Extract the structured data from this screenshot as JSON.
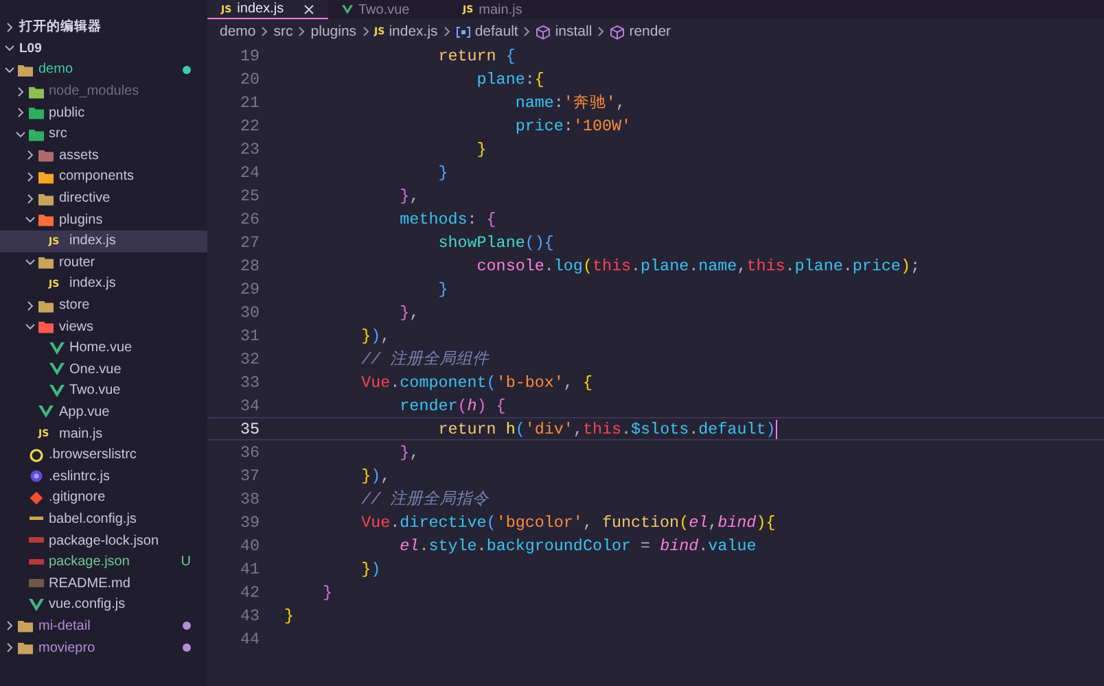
{
  "sidebar": {
    "items": [
      {
        "name": "打开的编辑器",
        "kind": "section",
        "expanded": false,
        "selected": false
      },
      {
        "name": "L09",
        "kind": "section",
        "expanded": true,
        "selected": false,
        "children": [
          {
            "name": "demo",
            "kind": "folder",
            "expanded": true,
            "selected": false,
            "color": "#3ec9a7",
            "dot": true,
            "children": [
              {
                "name": "node_modules",
                "kind": "folder-node",
                "expanded": false,
                "selected": false,
                "color": "#6f6c80"
              },
              {
                "name": "public",
                "kind": "folder-public",
                "expanded": false,
                "selected": false
              },
              {
                "name": "src",
                "kind": "folder-src",
                "expanded": true,
                "selected": false,
                "children": [
                  {
                    "name": "assets",
                    "kind": "folder-assets",
                    "expanded": false,
                    "selected": false
                  },
                  {
                    "name": "components",
                    "kind": "folder-components",
                    "expanded": false,
                    "selected": false
                  },
                  {
                    "name": "directive",
                    "kind": "folder",
                    "expanded": false,
                    "selected": false
                  },
                  {
                    "name": "plugins",
                    "kind": "folder-plugins",
                    "expanded": true,
                    "selected": false,
                    "children": [
                      {
                        "name": "index.js",
                        "kind": "js",
                        "icon_label": "JS",
                        "selected": true
                      }
                    ]
                  },
                  {
                    "name": "router",
                    "kind": "folder",
                    "expanded": true,
                    "selected": false,
                    "children": [
                      {
                        "name": "index.js",
                        "kind": "js",
                        "icon_label": "JS",
                        "selected": false
                      }
                    ]
                  },
                  {
                    "name": "store",
                    "kind": "folder",
                    "expanded": false,
                    "selected": false
                  },
                  {
                    "name": "views",
                    "kind": "folder-views",
                    "expanded": true,
                    "selected": false,
                    "children": [
                      {
                        "name": "Home.vue",
                        "kind": "vue",
                        "selected": false
                      },
                      {
                        "name": "One.vue",
                        "kind": "vue",
                        "selected": false
                      },
                      {
                        "name": "Two.vue",
                        "kind": "vue",
                        "selected": false
                      }
                    ]
                  },
                  {
                    "name": "App.vue",
                    "kind": "vue",
                    "selected": false
                  },
                  {
                    "name": "main.js",
                    "kind": "js",
                    "icon_label": "JS",
                    "selected": false
                  }
                ]
              },
              {
                "name": ".browserslistrc",
                "kind": "ring",
                "selected": false
              },
              {
                "name": ".eslintrc.js",
                "kind": "eslint",
                "selected": false
              },
              {
                "name": ".gitignore",
                "kind": "git",
                "selected": false
              },
              {
                "name": "babel.config.js",
                "kind": "babel",
                "selected": false
              },
              {
                "name": "package-lock.json",
                "kind": "npm",
                "selected": false
              },
              {
                "name": "package.json",
                "kind": "npm",
                "selected": false,
                "color": "#73c991",
                "badge": "U"
              },
              {
                "name": "README.md",
                "kind": "readme",
                "selected": false
              },
              {
                "name": "vue.config.js",
                "kind": "vue",
                "selected": false
              }
            ]
          },
          {
            "name": "mi-detail",
            "kind": "folder",
            "expanded": false,
            "selected": false,
            "color": "#b38ed6",
            "dot": true
          },
          {
            "name": "moviepro",
            "kind": "folder",
            "expanded": false,
            "selected": false,
            "color": "#b38ed6",
            "dot": true
          }
        ]
      }
    ]
  },
  "tabs": [
    {
      "label": "index.js",
      "kind": "js",
      "icon_label": "JS",
      "selected": true,
      "closable": true
    },
    {
      "label": "Two.vue",
      "kind": "vue",
      "selected": false,
      "closable": false
    },
    {
      "label": "main.js",
      "kind": "js",
      "icon_label": "JS",
      "selected": false,
      "closable": false
    }
  ],
  "breadcrumb": [
    {
      "text": "demo",
      "kind": "plain"
    },
    {
      "text": "src",
      "kind": "plain"
    },
    {
      "text": "plugins",
      "kind": "plain"
    },
    {
      "text": "index.js",
      "kind": "js",
      "icon_label": "JS"
    },
    {
      "text": "default",
      "kind": "variable"
    },
    {
      "text": "install",
      "kind": "method"
    },
    {
      "text": "render",
      "kind": "method"
    }
  ],
  "editor": {
    "lines": [
      {
        "number": "19",
        "current": false,
        "tokens": [
          {
            "kind": "keyword",
            "text": "                return"
          },
          {
            "kind": "b3",
            "text": " {"
          }
        ]
      },
      {
        "number": "20",
        "current": false,
        "tokens": [
          {
            "kind": "prop",
            "text": "                    plane"
          },
          {
            "kind": "punct",
            "text": ":"
          },
          {
            "kind": "b1",
            "text": "{"
          }
        ]
      },
      {
        "number": "21",
        "current": false,
        "tokens": [
          {
            "kind": "prop",
            "text": "                        name"
          },
          {
            "kind": "punct",
            "text": ":"
          },
          {
            "kind": "string",
            "text": "'奔驰'"
          },
          {
            "kind": "punct",
            "text": ","
          }
        ]
      },
      {
        "number": "22",
        "current": false,
        "tokens": [
          {
            "kind": "prop",
            "text": "                        price"
          },
          {
            "kind": "punct",
            "text": ":"
          },
          {
            "kind": "string",
            "text": "'100W'"
          }
        ]
      },
      {
        "number": "23",
        "current": false,
        "tokens": [
          {
            "kind": "b1",
            "text": "                    }"
          }
        ]
      },
      {
        "number": "24",
        "current": false,
        "tokens": [
          {
            "kind": "b3",
            "text": "                }"
          }
        ]
      },
      {
        "number": "25",
        "current": false,
        "tokens": [
          {
            "kind": "b2",
            "text": "            }"
          },
          {
            "kind": "punct",
            "text": ","
          }
        ]
      },
      {
        "number": "26",
        "current": false,
        "tokens": [
          {
            "kind": "prop",
            "text": "            methods"
          },
          {
            "kind": "punct",
            "text": ":"
          },
          {
            "kind": "b2",
            "text": " {"
          }
        ]
      },
      {
        "number": "27",
        "current": false,
        "tokens": [
          {
            "kind": "method",
            "text": "                showPlane"
          },
          {
            "kind": "b3",
            "text": "(){"
          }
        ]
      },
      {
        "number": "28",
        "current": false,
        "tokens": [
          {
            "kind": "object",
            "text": "                    console"
          },
          {
            "kind": "punct",
            "text": "."
          },
          {
            "kind": "prop",
            "text": "log"
          },
          {
            "kind": "b1",
            "text": "("
          },
          {
            "kind": "this",
            "text": "this"
          },
          {
            "kind": "punct",
            "text": "."
          },
          {
            "kind": "prop",
            "text": "plane"
          },
          {
            "kind": "punct",
            "text": "."
          },
          {
            "kind": "prop",
            "text": "name"
          },
          {
            "kind": "punct",
            "text": ","
          },
          {
            "kind": "this",
            "text": "this"
          },
          {
            "kind": "punct",
            "text": "."
          },
          {
            "kind": "prop",
            "text": "plane"
          },
          {
            "kind": "punct",
            "text": "."
          },
          {
            "kind": "prop",
            "text": "price"
          },
          {
            "kind": "b1",
            "text": ")"
          },
          {
            "kind": "punct",
            "text": ";"
          }
        ]
      },
      {
        "number": "29",
        "current": false,
        "tokens": [
          {
            "kind": "b3",
            "text": "                }"
          }
        ]
      },
      {
        "number": "30",
        "current": false,
        "tokens": [
          {
            "kind": "b2",
            "text": "            }"
          },
          {
            "kind": "punct",
            "text": ","
          }
        ]
      },
      {
        "number": "31",
        "current": false,
        "tokens": [
          {
            "kind": "b1",
            "text": "        }"
          },
          {
            "kind": "b3",
            "text": ")"
          },
          {
            "kind": "punct",
            "text": ","
          }
        ]
      },
      {
        "number": "32",
        "current": false,
        "tokens": [
          {
            "kind": "comment",
            "text": "        // 注册全局组件"
          }
        ]
      },
      {
        "number": "33",
        "current": false,
        "tokens": [
          {
            "kind": "class",
            "text": "        Vue"
          },
          {
            "kind": "punct",
            "text": "."
          },
          {
            "kind": "prop",
            "text": "component"
          },
          {
            "kind": "b3",
            "text": "("
          },
          {
            "kind": "string",
            "text": "'b-box'"
          },
          {
            "kind": "punct",
            "text": ","
          },
          {
            "kind": "b1",
            "text": " {"
          }
        ]
      },
      {
        "number": "34",
        "current": false,
        "tokens": [
          {
            "kind": "prop",
            "text": "            render"
          },
          {
            "kind": "b2",
            "text": "("
          },
          {
            "kind": "param",
            "text": "h"
          },
          {
            "kind": "b2",
            "text": ")"
          },
          {
            "kind": "b2",
            "text": " {"
          }
        ]
      },
      {
        "number": "35",
        "current": true,
        "tokens": [
          {
            "kind": "keyword",
            "text": "                return"
          },
          {
            "kind": "call",
            "text": " h"
          },
          {
            "kind": "b3",
            "text": "("
          },
          {
            "kind": "string",
            "text": "'div'"
          },
          {
            "kind": "punct",
            "text": ","
          },
          {
            "kind": "this",
            "text": "this"
          },
          {
            "kind": "punct",
            "text": "."
          },
          {
            "kind": "prop",
            "text": "$slots"
          },
          {
            "kind": "punct",
            "text": "."
          },
          {
            "kind": "prop",
            "text": "default"
          },
          {
            "kind": "b3",
            "text": ")"
          }
        ]
      },
      {
        "number": "36",
        "current": false,
        "tokens": [
          {
            "kind": "b2",
            "text": "            }"
          },
          {
            "kind": "punct",
            "text": ","
          }
        ]
      },
      {
        "number": "37",
        "current": false,
        "tokens": [
          {
            "kind": "b1",
            "text": "        }"
          },
          {
            "kind": "b3",
            "text": ")"
          },
          {
            "kind": "punct",
            "text": ","
          }
        ]
      },
      {
        "number": "38",
        "current": false,
        "tokens": [
          {
            "kind": "comment",
            "text": "        // 注册全局指令"
          }
        ]
      },
      {
        "number": "39",
        "current": false,
        "tokens": [
          {
            "kind": "class",
            "text": "        Vue"
          },
          {
            "kind": "punct",
            "text": "."
          },
          {
            "kind": "prop",
            "text": "directive"
          },
          {
            "kind": "b3",
            "text": "("
          },
          {
            "kind": "string",
            "text": "'bgcolor'"
          },
          {
            "kind": "punct",
            "text": ","
          },
          {
            "kind": "keyword",
            "text": " function"
          },
          {
            "kind": "b1",
            "text": "("
          },
          {
            "kind": "param",
            "text": "el"
          },
          {
            "kind": "punct",
            "text": ","
          },
          {
            "kind": "param",
            "text": "bind"
          },
          {
            "kind": "b1",
            "text": "){"
          }
        ]
      },
      {
        "number": "40",
        "current": false,
        "tokens": [
          {
            "kind": "param",
            "text": "            el"
          },
          {
            "kind": "punct",
            "text": "."
          },
          {
            "kind": "prop",
            "text": "style"
          },
          {
            "kind": "punct",
            "text": "."
          },
          {
            "kind": "prop",
            "text": "backgroundColor"
          },
          {
            "kind": "punct",
            "text": " = "
          },
          {
            "kind": "param",
            "text": "bind"
          },
          {
            "kind": "punct",
            "text": "."
          },
          {
            "kind": "prop",
            "text": "value"
          }
        ]
      },
      {
        "number": "41",
        "current": false,
        "tokens": [
          {
            "kind": "b1",
            "text": "        }"
          },
          {
            "kind": "b3",
            "text": ")"
          }
        ]
      },
      {
        "number": "42",
        "current": false,
        "tokens": [
          {
            "kind": "b2",
            "text": "    }"
          }
        ]
      },
      {
        "number": "43",
        "current": false,
        "tokens": [
          {
            "kind": "b1",
            "text": "}"
          }
        ]
      },
      {
        "number": "44",
        "current": false
      }
    ]
  }
}
